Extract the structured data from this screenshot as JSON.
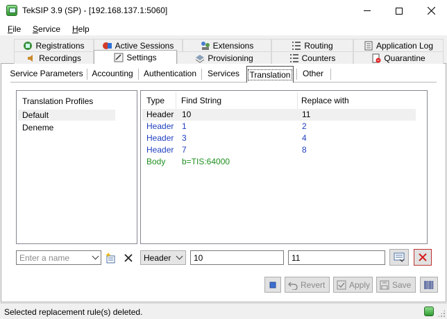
{
  "window": {
    "title": "TekSIP 3.9 (SP) - [192.168.137.1:5060]",
    "min_label": "Minimize",
    "max_label": "Maximize",
    "close_label": "Close"
  },
  "menu": [
    {
      "u": "F",
      "rest": "ile"
    },
    {
      "u": "S",
      "rest": "ervice"
    },
    {
      "u": "H",
      "rest": "elp"
    }
  ],
  "main_tabs": {
    "row1": [
      "Registrations",
      "Active Sessions",
      "Extensions",
      "Routing",
      "Application Log"
    ],
    "row2": [
      "Recordings",
      "Settings",
      "Provisioning",
      "Counters",
      "Quarantine"
    ],
    "active": "Settings"
  },
  "sub_tabs": {
    "items": [
      "Service Parameters",
      "Accounting",
      "Authentication",
      "Services",
      "Translation",
      "Other"
    ],
    "active": "Translation"
  },
  "profiles": {
    "header": "Translation Profiles",
    "items": [
      "Default",
      "Deneme"
    ],
    "selected": 0
  },
  "rules": {
    "columns": [
      "Type",
      "Find String",
      "Replace with"
    ],
    "rows": [
      {
        "type": "Header",
        "find": "10",
        "replace": "11",
        "color": "#000000"
      },
      {
        "type": "Header",
        "find": "1",
        "replace": "2",
        "color": "#1f3fbf"
      },
      {
        "type": "Header",
        "find": "3",
        "replace": "4",
        "color": "#1f3fbf"
      },
      {
        "type": "Header",
        "find": "7",
        "replace": "8",
        "color": "#1f3fbf"
      },
      {
        "type": "Body",
        "find": "b=TIS:64000",
        "replace": "",
        "color": "#1f8f1f"
      }
    ],
    "selected": 0
  },
  "editor": {
    "name_placeholder": "Enter a name",
    "type_value": "Header",
    "find_value": "10",
    "replace_value": "11"
  },
  "toolbar": {
    "revert_label": "Revert",
    "apply_label": "Apply",
    "save_label": "Save"
  },
  "status": {
    "text": "Selected replacement rule(s) deleted."
  }
}
